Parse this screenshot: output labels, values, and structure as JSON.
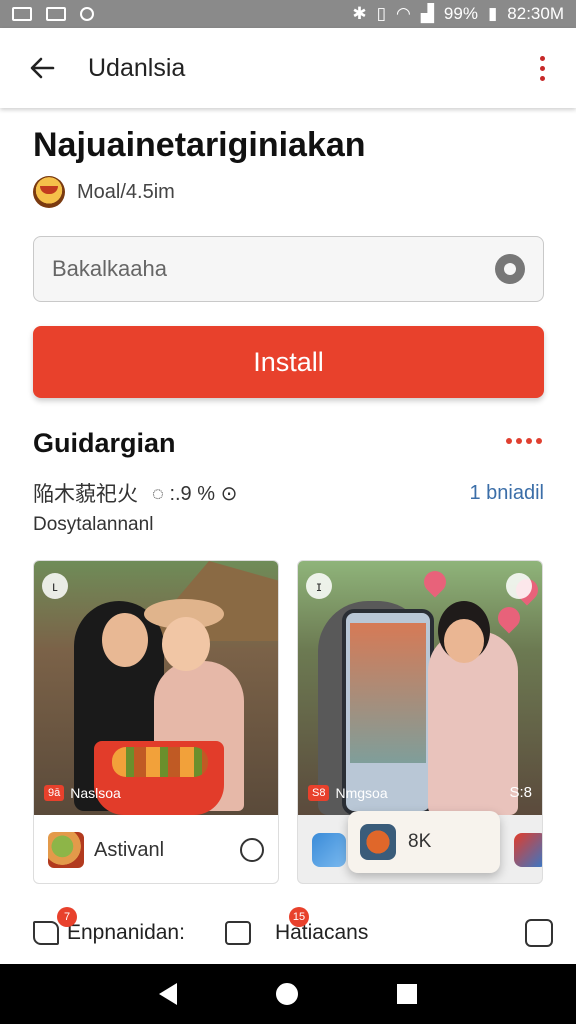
{
  "status_bar": {
    "battery": "99%",
    "time": "82:30M"
  },
  "app_bar": {
    "title": "Udanlsia"
  },
  "header": {
    "title": "Najuainetariginiakan",
    "meta": "Moal/4.5im"
  },
  "search": {
    "placeholder": "Bakalkaaha"
  },
  "install_button": {
    "label": "Install"
  },
  "section": {
    "title": "Guidargian",
    "stats_text": "陥木藐祀火",
    "stats_icons_text": "◌ :.9 % ⊙",
    "link": "1 bniadil",
    "subtitle": "Dosytalannanl"
  },
  "cards": [
    {
      "photo_tag": "9ā",
      "photo_label": "Naslsoa",
      "badge": "ʟ",
      "footer_text": "Astivanl"
    },
    {
      "photo_tag": "S8",
      "photo_label": "Nmgsoa",
      "badge": "ɪ",
      "photo_count": "S:8",
      "popup_text": "8K"
    }
  ],
  "bottom_row": {
    "item1_label": "Enpnanidan:",
    "item1_notif": "7",
    "item2_label": "Hatiacans",
    "item2_notif": "15"
  },
  "colors": {
    "accent": "#e8412c",
    "link": "#3b6ea8"
  },
  "icons": [
    "back-arrow-icon",
    "more-vert-icon",
    "settings-icon",
    "chat-icon",
    "navigation-back-icon",
    "navigation-home-icon",
    "navigation-recents-icon"
  ]
}
